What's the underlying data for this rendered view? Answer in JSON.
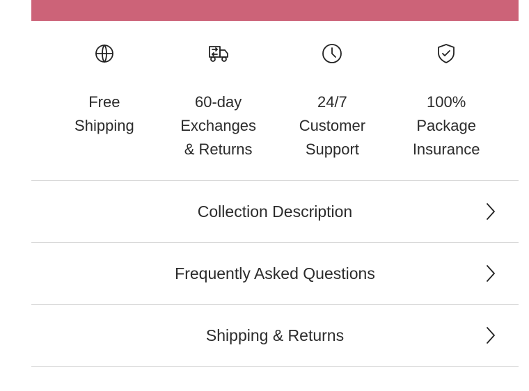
{
  "colors": {
    "accent": "#cc6378"
  },
  "features": [
    {
      "icon": "globe-icon",
      "label": "Free\nShipping"
    },
    {
      "icon": "truck-icon",
      "label": "60-day\nExchanges\n& Returns"
    },
    {
      "icon": "clock-icon",
      "label": "24/7\nCustomer\nSupport"
    },
    {
      "icon": "shield-check-icon",
      "label": "100%\nPackage\nInsurance"
    }
  ],
  "accordion": [
    {
      "title": "Collection Description",
      "icon": "chevron-right-icon"
    },
    {
      "title": "Frequently Asked Questions",
      "icon": "chevron-right-icon"
    },
    {
      "title": "Shipping & Returns",
      "icon": "chevron-right-icon"
    }
  ]
}
